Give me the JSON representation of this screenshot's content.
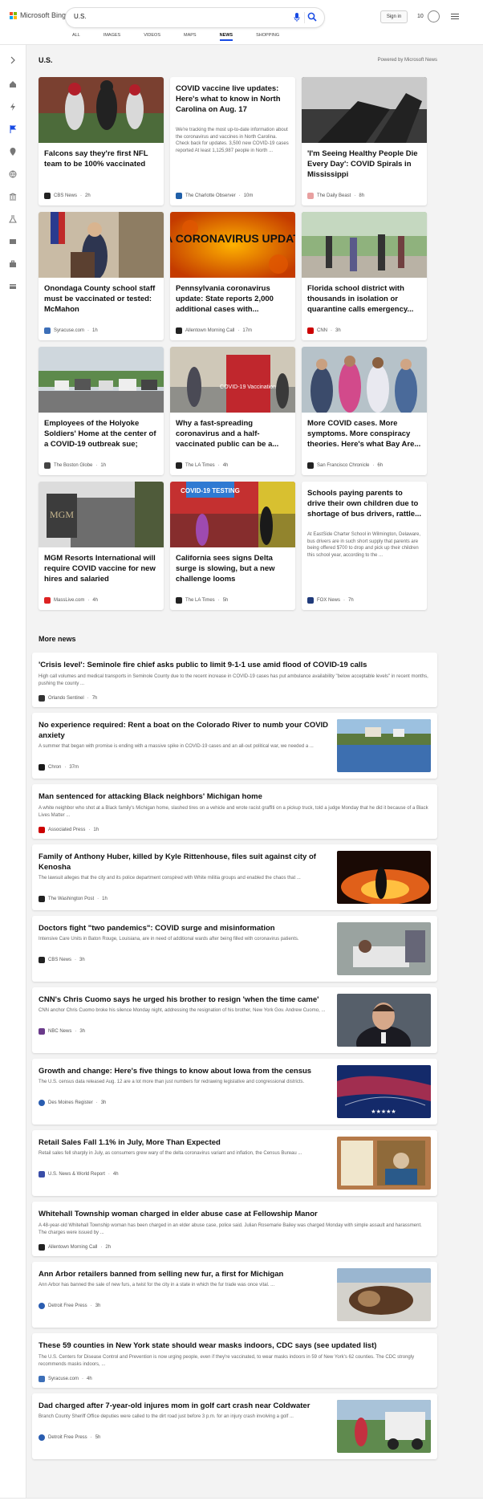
{
  "header": {
    "brand": "Microsoft Bing",
    "query": "U.S.",
    "signin_label": "Sign in",
    "rewards_count": "10",
    "tabs": [
      "ALL",
      "IMAGES",
      "VIDEOS",
      "MAPS",
      "NEWS",
      "SHOPPING"
    ],
    "active_tab": "NEWS"
  },
  "section": {
    "title": "U.S.",
    "powered": "Powered by Microsoft News"
  },
  "cards": [
    {
      "title": "Falcons say they're first NFL team to be 100% vaccinated",
      "source": "CBS News",
      "time": "2h",
      "has_image": true
    },
    {
      "title": "COVID vaccine live updates: Here's what to know in North Carolina on Aug. 17",
      "snippet": "We're tracking the most up-to-date information about the coronavirus and vaccines in North Carolina. Check back for updates. 3,500 new COVID-19 cases reported At least 1,125,987 people in North ...",
      "source": "The Charlotte Observer",
      "time": "10m",
      "has_image": false
    },
    {
      "title": "'I'm Seeing Healthy People Die Every Day': COVID Spirals in Mississippi",
      "source": "The Daily Beast",
      "time": "8h",
      "has_image": true
    },
    {
      "title": "Onondaga County school staff must be vaccinated or tested: McMahon",
      "source": "Syracuse.com",
      "time": "1h",
      "has_image": true
    },
    {
      "title": "Pennsylvania coronavirus update: State reports 2,000 additional cases with...",
      "source": "Allentown Morning Call",
      "time": "17m",
      "has_image": true,
      "image_text": "PA CORONAVIRUS UPDATE"
    },
    {
      "title": "Florida school district with thousands in isolation or quarantine calls emergency...",
      "source": "CNN",
      "time": "3h",
      "has_image": true
    },
    {
      "title": "Employees of the Holyoke Soldiers' Home at the center of a COVID-19 outbreak sue; Am...",
      "source": "The Boston Globe",
      "time": "1h",
      "has_image": true
    },
    {
      "title": "Why a fast-spreading coronavirus and a half-vaccinated public can be a...",
      "source": "The LA Times",
      "time": "4h",
      "has_image": true,
      "image_text": "COVID-19 Vaccination"
    },
    {
      "title": "More COVID cases. More symptoms. More conspiracy theories. Here's what Bay Are...",
      "source": "San Francisco Chronicle",
      "time": "6h",
      "has_image": true
    },
    {
      "title": "MGM Resorts International will require COVID vaccine for new hires and salaried employees,...",
      "source": "MassLive.com",
      "time": "4h",
      "has_image": true
    },
    {
      "title": "California sees signs Delta surge is slowing, but a new challenge looms",
      "source": "The LA Times",
      "time": "5h",
      "has_image": true,
      "image_text": "COVID-19 TESTING"
    },
    {
      "title": "Schools paying parents to drive their own children due to shortage of bus drivers, rattle...",
      "snippet": "At EastSide Charter School in Wilmington, Delaware, bus drivers are in such short supply that parents are being offered $700 to drop and pick up their children this school year, according to the ...",
      "source": "FOX News",
      "time": "7h",
      "has_image": false
    }
  ],
  "more_news": {
    "title": "More news",
    "items": [
      {
        "title": "'Crisis level': Seminole fire chief asks public to limit 9-1-1 use amid flood of COVID-19 calls",
        "snippet": "High call volumes and medical transports in Seminole County due to the recent increase in COVID-19 cases has put ambulance availability \"below acceptable levels\" in recent months, pushing the county ...",
        "source": "Orlando Sentinel",
        "time": "7h",
        "has_image": false
      },
      {
        "title": "No experience required: Rent a boat on the Colorado River to numb your COVID anxiety",
        "snippet": "A summer that began with promise is ending with a massive spike in COVID-19 cases and an all-out political war, we needed a ...",
        "source": "Chron",
        "time": "37m",
        "has_image": true
      },
      {
        "title": "Man sentenced for attacking Black neighbors' Michigan home",
        "snippet": "A white neighbor who shot at a Black family's Michigan home, slashed tires on a vehicle and wrote racist graffiti on a pickup truck, told a judge Monday that he did it because of a Black Lives Matter ...",
        "source": "Associated Press",
        "time": "1h",
        "has_image": false
      },
      {
        "title": "Family of Anthony Huber, killed by Kyle Rittenhouse, files suit against city of Kenosha",
        "snippet": "The lawsuit alleges that the city and its police department conspired with White militia groups and enabled the chaos that ...",
        "source": "The Washington Post",
        "time": "1h",
        "has_image": true
      },
      {
        "title": "Doctors fight \"two pandemics\": COVID surge and misinformation",
        "snippet": "Intensive Care Units in Baton Rouge, Louisiana, are in need of additional wards after being filled with coronavirus patients.",
        "source": "CBS News",
        "time": "3h",
        "has_image": true
      },
      {
        "title": "CNN's Chris Cuomo says he urged his brother to resign 'when the time came'",
        "snippet": "CNN anchor Chris Cuomo broke his silence Monday night, addressing the resignation of his brother, New York Gov. Andrew Cuomo, ...",
        "source": "NBC News",
        "time": "3h",
        "has_image": true
      },
      {
        "title": "Growth and change: Here's five things to know about Iowa from the census",
        "snippet": "The U.S. census data released Aug. 12 are a lot more than just numbers for redrawing legislative and congressional districts.",
        "source": "Des Moines Register",
        "time": "3h",
        "has_image": true
      },
      {
        "title": "Retail Sales Fall 1.1% in July, More Than Expected",
        "snippet": "Retail sales fell sharply in July, as consumers grew wary of the delta coronavirus variant and inflation, the Census Bureau ...",
        "source": "U.S. News & World Report",
        "time": "4h",
        "has_image": true
      },
      {
        "title": "Whitehall Township woman charged in elder abuse case at Fellowship Manor",
        "snippet": "A 48-year-old Whitehall Township woman has been charged in an elder abuse case, police said. Julian Rosemarie Bailey was charged Monday with simple assault and harassment. The charges were issued by ...",
        "source": "Allentown Morning Call",
        "time": "2h",
        "has_image": false
      },
      {
        "title": "Ann Arbor retailers banned from selling new fur, a first for Michigan",
        "snippet": "Ann Arbor has banned the sale of new furs, a twist for the city in a state in which the fur trade was once vital. ...",
        "source": "Detroit Free Press",
        "time": "3h",
        "has_image": true
      },
      {
        "title": "These 59 counties in New York state should wear masks indoors, CDC says (see updated list)",
        "snippet": "The U.S. Centers for Disease Control and Prevention is now urging people, even if they're vaccinated, to wear masks indoors in 59 of New York's 62 counties. The CDC strongly recommends masks indoors, ...",
        "source": "Syracuse.com",
        "time": "4h",
        "has_image": false
      },
      {
        "title": "Dad charged after 7-year-old injures mom in golf cart crash near Coldwater",
        "snippet": "Branch County Sheriff Office deputies were called to the dirt road just before 3 p.m. for an injury crash involving a golf ...",
        "source": "Detroit Free Press",
        "time": "5h",
        "has_image": true
      }
    ]
  },
  "colors": {
    "accent": "#174ae4",
    "bing_blue": "#1a73e8"
  }
}
